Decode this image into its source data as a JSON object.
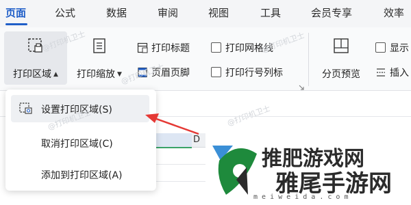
{
  "tabs": [
    {
      "label": "页面",
      "active": true
    },
    {
      "label": "公式"
    },
    {
      "label": "数据"
    },
    {
      "label": "审阅"
    },
    {
      "label": "视图"
    },
    {
      "label": "工具"
    },
    {
      "label": "会员专享"
    },
    {
      "label": "效率"
    }
  ],
  "ribbon": {
    "print_area": {
      "label": "打印区域"
    },
    "print_scale": {
      "label": "打印缩放"
    },
    "print_titles": {
      "label": "打印标题"
    },
    "header_footer": {
      "label": "页眉页脚"
    },
    "print_gridlines": {
      "label": "打印网格线",
      "checked": false
    },
    "print_row_col_headers": {
      "label": "打印行号列标",
      "checked": false
    },
    "page_break_preview": {
      "label": "分页预览"
    },
    "show_label": {
      "label": "显示",
      "checked": false
    },
    "insert_label": {
      "label": "插入"
    }
  },
  "menu": {
    "items": [
      {
        "label": "设置打印区域(S)",
        "hover": true
      },
      {
        "label": "取消打印区域(C)"
      },
      {
        "label": "添加到打印区域(A)"
      }
    ]
  },
  "sheet": {
    "column_label": "D"
  },
  "watermark": {
    "text": "@打印机卫士"
  },
  "logo": {
    "line1": "推肥游戏网",
    "line2": "雅尾手游网",
    "url": "m e i w e i d a . c o m"
  },
  "colors": {
    "accent": "#1f5ec8",
    "arrow": "#e53935",
    "logo_green": "#1e8a3c"
  }
}
